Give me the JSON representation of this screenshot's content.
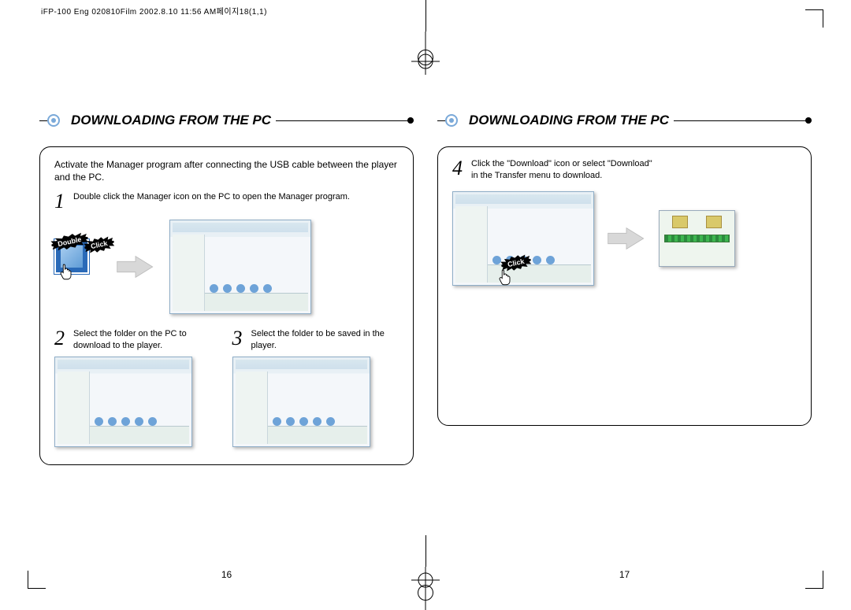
{
  "header_text": "iFP-100 Eng 020810Film 2002.8.10 11:56 AM페이지18(1,1)",
  "left": {
    "heading": "DOWNLOADING FROM THE PC",
    "intro": "Activate the Manager program after connecting  the USB cable between the player and  the PC.",
    "step1_num": "1",
    "step1_text": "Double click the Manager icon on the PC to open the Manager program.",
    "burst_double": "Double",
    "burst_click": "Click",
    "step2_num": "2",
    "step2_text": "Select the folder on the PC to download to the player.",
    "step3_num": "3",
    "step3_text": "Select the folder to be saved in the player.",
    "page_num": "16"
  },
  "right": {
    "heading": "DOWNLOADING FROM THE PC",
    "step4_num": "4",
    "step4_text": "Click the \"Download\" icon or select \"Download\" in the Transfer menu to download.",
    "burst_click": "Click",
    "page_num": "17"
  }
}
